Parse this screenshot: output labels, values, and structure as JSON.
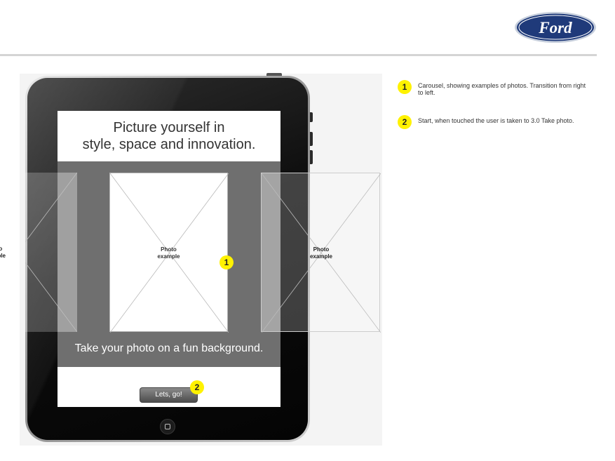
{
  "brand": {
    "logo_text": "Ford",
    "colors": {
      "oval": "#1f3a7a",
      "ring": "#c7cfdc"
    }
  },
  "device": {
    "type": "tablet",
    "home_button_icon": "home-square-icon"
  },
  "screen": {
    "headline": "Picture yourself in\nstyle, space and innovation.",
    "carousel": {
      "photos": [
        {
          "label": "Photo\nexample",
          "position": "previous"
        },
        {
          "label": "Photo\nexample",
          "position": "current"
        },
        {
          "label": "Photo\nexample",
          "position": "next"
        }
      ]
    },
    "tagline": "Take your photo on a fun background.",
    "start_button_label": "Lets, go!"
  },
  "markers": {
    "carousel": "1",
    "start": "2",
    "color": "#fff200"
  },
  "annotations": [
    {
      "number": "1",
      "text": "Carousel, showing examples of photos. Transition from right to left."
    },
    {
      "number": "2",
      "text": "Start, when touched the user is taken to 3.0 Take photo."
    }
  ]
}
